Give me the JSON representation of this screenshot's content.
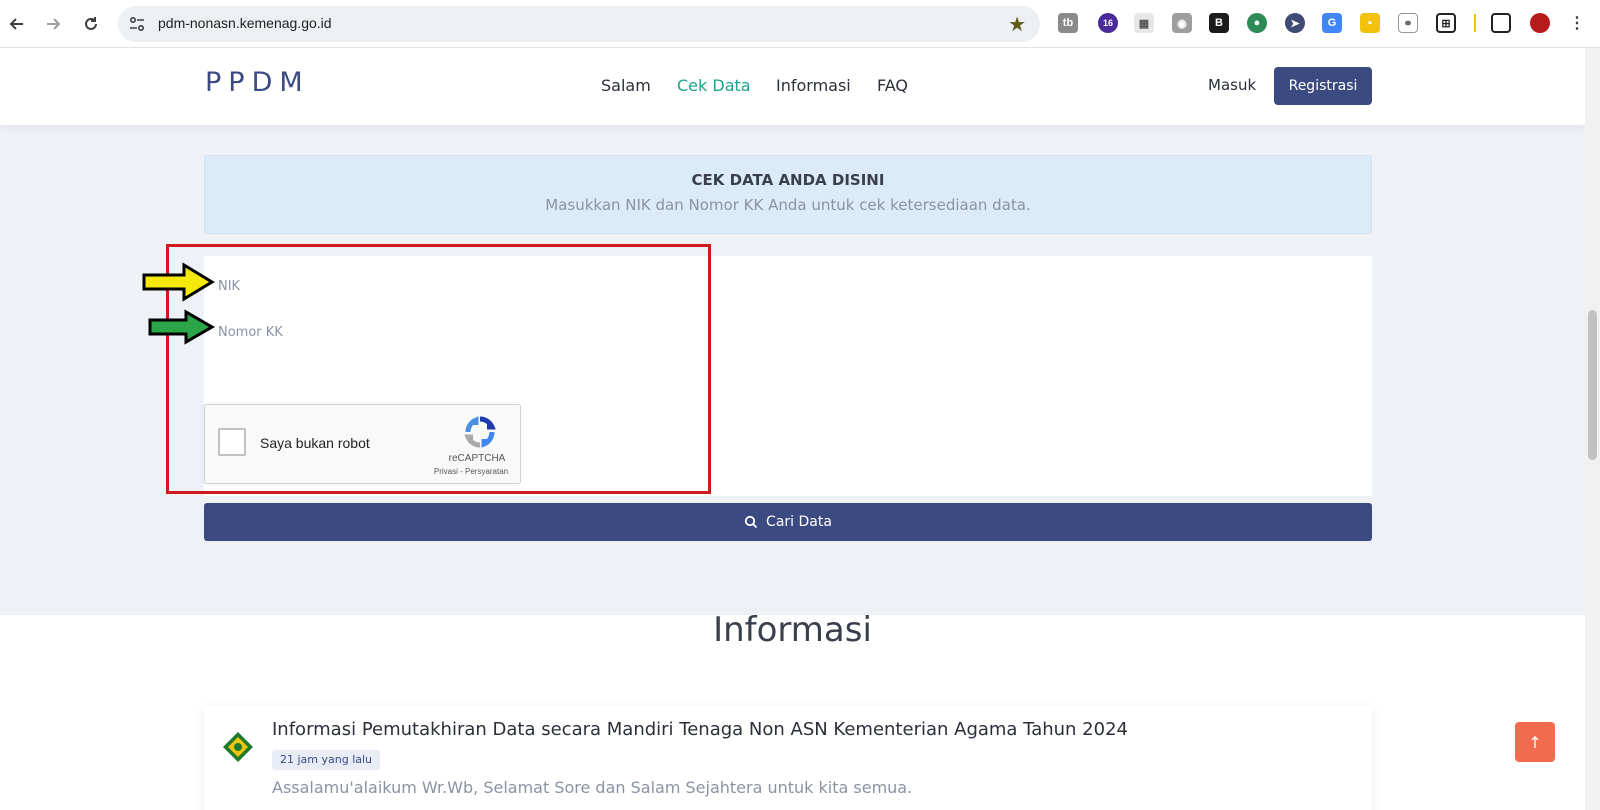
{
  "browser": {
    "url": "pdm-nonasn.kemenag.go.id",
    "ext_badge": "16"
  },
  "header": {
    "logo": "PPDM",
    "menu": [
      "Salam",
      "Cek Data",
      "Informasi",
      "FAQ"
    ],
    "active_menu": "Cek Data",
    "login": "Masuk",
    "register": "Registrasi"
  },
  "check": {
    "title": "CEK DATA ANDA DISINI",
    "subtitle": "Masukkan NIK dan Nomor KK Anda untuk cek ketersediaan data.",
    "nik_placeholder": "NIK",
    "kk_placeholder": "Nomor KK",
    "search_button": "Cari Data"
  },
  "captcha": {
    "label": "Saya bukan robot",
    "brand": "reCAPTCHA",
    "terms": "Privasi - Persyaratan"
  },
  "info": {
    "section_title": "Informasi",
    "items": [
      {
        "title": "Informasi Pemutakhiran Data secara Mandiri Tenaga Non ASN Kementerian Agama Tahun 2024",
        "time": "21 jam yang lalu",
        "excerpt": "Assalamu'alaikum Wr.Wb, Selamat Sore dan Salam Sejahtera untuk kita semua."
      }
    ]
  },
  "colors": {
    "brand": "#3c4a82",
    "accent": "#19a58d",
    "highlight_frame": "#d0191f",
    "arrow_nik": "#f5e90c",
    "arrow_kk": "#2aa548",
    "to_top": "#f26b4f"
  },
  "icons": [
    "back-icon",
    "forward-icon",
    "reload-icon",
    "site-settings-icon",
    "bookmark-star-icon",
    "search-icon",
    "arrow-up-icon",
    "menu-dots-icon"
  ]
}
